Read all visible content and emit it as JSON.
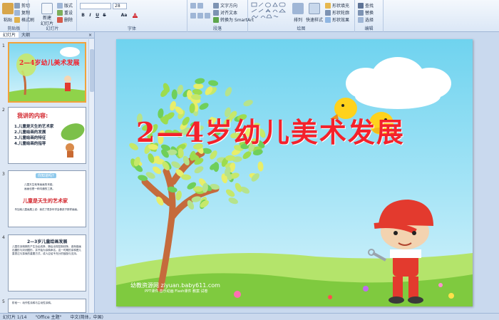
{
  "ribbon": {
    "clipboard": {
      "label": "剪贴板",
      "paste": "粘贴",
      "cut": "剪切",
      "copy": "复制",
      "format_painter": "格式刷"
    },
    "slides": {
      "label": "幻灯片",
      "new_slide": "新建",
      "new_slide2": "幻灯片",
      "layout": "版式",
      "reset": "重设",
      "delete": "删除"
    },
    "font": {
      "label": "字体",
      "font_size": "28",
      "bold": "B",
      "italic": "I",
      "underline": "U",
      "strike": "S",
      "case": "Aa",
      "font_color": "A"
    },
    "paragraph": {
      "label": "段落",
      "text_direction": "文字方向",
      "align_text": "对齐文本",
      "smartart": "转换为 SmartArt"
    },
    "drawing": {
      "label": "绘图",
      "arrange": "排列",
      "quick_styles": "快速样式",
      "shape_fill": "形状填充",
      "shape_outline": "形状轮廓",
      "shape_effects": "形状效果"
    },
    "editing": {
      "label": "编辑",
      "find": "查找",
      "replace": "替换",
      "select": "选择"
    }
  },
  "pane": {
    "tab_slides": "幻灯片",
    "tab_outline": "大纲",
    "close": "×",
    "thumbs": [
      {
        "num": "1",
        "title": "2—4岁幼儿美术发展"
      },
      {
        "num": "2",
        "heading": "我讲的内容:",
        "items": [
          "1.儿童是天生的艺术家",
          "2.儿童绘画的发展",
          "3.儿童绘画的特征",
          "4.儿童绘画的指导"
        ]
      },
      {
        "num": "3",
        "banner": "你知道吗?",
        "line1": "儿童天生就有画画的本能,",
        "line2": "画画也是一种沟通的工具。",
        "title": "儿童是天生的艺术家",
        "quote": "毕加索儿童画展上说：我花了很多年学会像孩子那样画画。"
      },
      {
        "num": "4",
        "title": "2—3岁儿童绘画发展",
        "body": "儿童在涂鸦期先产生杂乱线条，随后出现控制线条，逐渐能画出圆形与封闭图形，并开始为涂鸦命名。这一时期的涂鸦是儿童表达与探索的重要方式，成人应给予充分的鼓励与支持。"
      },
      {
        "num": "5",
        "body": "阶段一：动作性涂鸦与主动性涂鸦。"
      }
    ]
  },
  "slide": {
    "title": "2—4岁幼儿美术发展",
    "watermark": "幼教资源网 ziyuan.baby611.com",
    "watermark_sub": "PPT课件  音乐动画  Flash课件  教案  试卷"
  },
  "status": {
    "slide_pos": "幻灯片 1/14",
    "theme": "\"Office 主题\"",
    "language": "中文(简体，中国)"
  },
  "colors": {
    "title_red": "#f4212b",
    "sky": "#6fd3ef",
    "grass": "#8fd34a",
    "trunk": "#c56b3c"
  }
}
